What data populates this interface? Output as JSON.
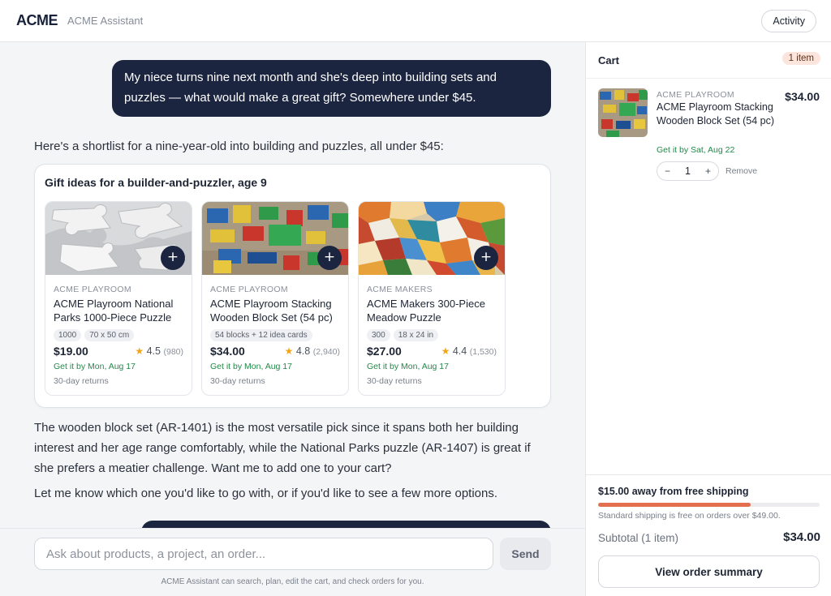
{
  "header": {
    "brand": "ACME",
    "subtitle": "ACME Assistant",
    "activity_label": "Activity"
  },
  "chat": {
    "user_message": "My niece turns nine next month and she's deep into building sets and puzzles — what would make a great gift? Somewhere under $45.",
    "assistant_intro": "Here's a shortlist for a nine-year-old into building and puzzles, all under $45:",
    "panel_title": "Gift ideas for a builder-and-puzzler, age 9",
    "products": [
      {
        "brand": "ACME PLAYROOM",
        "name": "ACME Playroom National Parks 1000-Piece Puzzle",
        "tags": [
          "1000",
          "70 x 50 cm"
        ],
        "price": "$19.00",
        "rating": "4.5",
        "rating_count": "(980)",
        "delivery": "Get it by Mon, Aug 17",
        "returns": "30-day returns",
        "image_icon": "puzzle-pieces-photo"
      },
      {
        "brand": "ACME PLAYROOM",
        "name": "ACME Playroom Stacking Wooden Block Set (54 pc)",
        "tags": [
          "54 blocks + 12 idea cards"
        ],
        "price": "$34.00",
        "rating": "4.8",
        "rating_count": "(2,940)",
        "delivery": "Get it by Mon, Aug 17",
        "returns": "30-day returns",
        "image_icon": "wooden-blocks-photo"
      },
      {
        "brand": "ACME MAKERS",
        "name": "ACME Makers 300-Piece Meadow Puzzle",
        "tags": [
          "300",
          "18 x 24 in"
        ],
        "price": "$27.00",
        "rating": "4.4",
        "rating_count": "(1,530)",
        "delivery": "Get it by Mon, Aug 17",
        "returns": "30-day returns",
        "image_icon": "colorful-puzzle-photo"
      }
    ],
    "add_symbol": "+",
    "star_symbol": "★",
    "assistant_followup": "The wooden block set (AR-1401) is the most versatile pick since it spans both her building interest and her age range comfortably, while the National Parks puzzle (AR-1407) is great if she prefers a meatier challenge. Want me to add one to your cart?",
    "assistant_closing": "Let me know which one you'd like to go with, or if you'd like to see a few more options."
  },
  "composer": {
    "placeholder": "Ask about products, a project, an order...",
    "send_label": "Send",
    "disclaimer": "ACME Assistant can search, plan, edit the cart, and check orders for you."
  },
  "cart": {
    "title": "Cart",
    "count_badge": "1 item",
    "item": {
      "brand": "ACME PLAYROOM",
      "name": "ACME Playroom Stacking Wooden Block Set (54 pc)",
      "price": "$34.00",
      "delivery": "Get it by Sat, Aug 22",
      "quantity": "1",
      "minus": "−",
      "plus": "+",
      "remove_label": "Remove"
    },
    "shipping": {
      "title": "$15.00 away from free shipping",
      "progress_fraction": 0.69,
      "note": "Standard shipping is free on orders over $49.00."
    },
    "subtotal_label": "Subtotal (1 item)",
    "subtotal_value": "$34.00",
    "summary_button": "View order summary"
  },
  "colors": {
    "brand_navy": "#1c2540",
    "accent_orange": "#e36f4f",
    "delivery_green": "#24894a",
    "star_gold": "#f2a516"
  }
}
